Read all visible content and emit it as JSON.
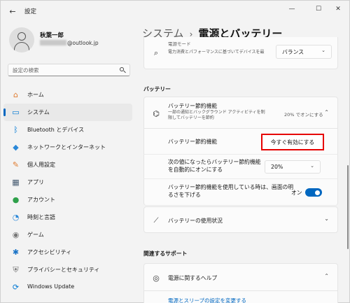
{
  "window": {
    "title": "設定",
    "back_icon": "←",
    "minimize_icon": "—",
    "maximize_icon": "☐",
    "close_icon": "✕"
  },
  "user": {
    "name": "秋葉一郎",
    "email_suffix": "@outlook.jp"
  },
  "search": {
    "placeholder": "設定の検索"
  },
  "sidebar": {
    "items": [
      {
        "label": "ホーム",
        "icon": "⌂",
        "color": "#e07a2e",
        "active": false
      },
      {
        "label": "システム",
        "icon": "▭",
        "color": "#0078d4",
        "active": true
      },
      {
        "label": "Bluetooth とデバイス",
        "icon": "ᛒ",
        "color": "#0078d4",
        "active": false
      },
      {
        "label": "ネットワークとインターネット",
        "icon": "◆",
        "color": "#2b88d8",
        "active": false
      },
      {
        "label": "個人用設定",
        "icon": "✎",
        "color": "#e07a2e",
        "active": false
      },
      {
        "label": "アプリ",
        "icon": "▦",
        "color": "#455a70",
        "active": false
      },
      {
        "label": "アカウント",
        "icon": "●",
        "color": "#2ea04a",
        "active": false
      },
      {
        "label": "時刻と言語",
        "icon": "◔",
        "color": "#2b88d8",
        "active": false
      },
      {
        "label": "ゲーム",
        "icon": "◉",
        "color": "#777777",
        "active": false
      },
      {
        "label": "アクセシビリティ",
        "icon": "✱",
        "color": "#1a73c7",
        "active": false
      },
      {
        "label": "プライバシーとセキュリティ",
        "icon": "⛨",
        "color": "#6b6b6b",
        "active": false
      },
      {
        "label": "Windows Update",
        "icon": "⟳",
        "color": "#0078d4",
        "active": false
      }
    ]
  },
  "main": {
    "breadcrumb_parent": "システム",
    "breadcrumb_sep": "›",
    "breadcrumb_current": "電源とバッテリー",
    "power_mode": {
      "title_partial": "電源モード",
      "desc": "電力消費とパフォーマンスに基づいてデバイスを最",
      "value": "バランス"
    },
    "battery_section": "バッテリー",
    "battery_saver": {
      "title": "バッテリー節約機能",
      "desc": "一部の通知とバックグラウンド アクティビティを制限してバッテリーを節約",
      "status": "20% でオンにする"
    },
    "saver_row": {
      "label": "バッテリー節約機能",
      "button": "今すぐ有効にする"
    },
    "auto_on_row": {
      "label": "次の値になったらバッテリー節約機能を自動的にオンにする",
      "value": "20%"
    },
    "brightness_row": {
      "label": "バッテリー節約機能を使用している時は、画面の明るさを下げる",
      "toggle_label": "オン",
      "toggle_on": true
    },
    "usage": {
      "title": "バッテリーの使用状況"
    },
    "related_section": "関連するサポート",
    "help": {
      "title": "電源に関するヘルプ"
    },
    "partial_link": "電源とスリープの設定を変更する"
  },
  "colors": {
    "accent": "#0067c0",
    "highlight_border": "#e60000"
  }
}
